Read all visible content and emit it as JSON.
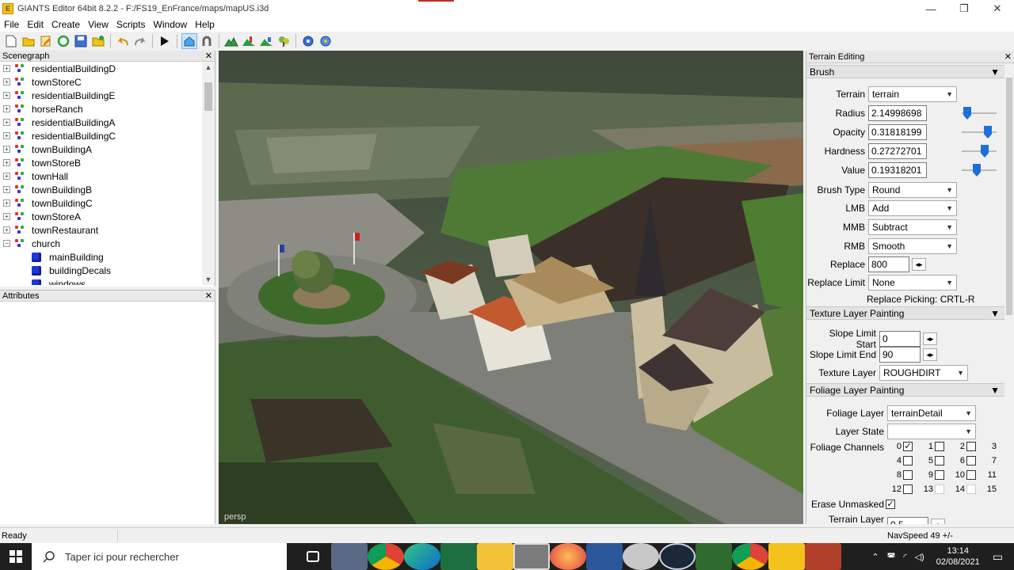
{
  "window": {
    "title": "GIANTS Editor 64bit 8.2.2 - F:/FS19_EnFrance/maps/mapUS.i3d",
    "app_icon": "E",
    "minimize": "—",
    "maximize": "❐",
    "close": "✕"
  },
  "menu": [
    "File",
    "Edit",
    "Create",
    "View",
    "Scripts",
    "Window",
    "Help"
  ],
  "scenegraph": {
    "title": "Scenegraph",
    "close": "✕",
    "items": [
      {
        "label": "residentialBuildingD",
        "type": "group",
        "expander": "+"
      },
      {
        "label": "townStoreC",
        "type": "group",
        "expander": "+"
      },
      {
        "label": "residentialBuildingE",
        "type": "group",
        "expander": "+"
      },
      {
        "label": "horseRanch",
        "type": "group",
        "expander": "+"
      },
      {
        "label": "residentialBuildingA",
        "type": "group",
        "expander": "+"
      },
      {
        "label": "residentialBuildingC",
        "type": "group",
        "expander": "+"
      },
      {
        "label": "townBuildingA",
        "type": "group",
        "expander": "+"
      },
      {
        "label": "townStoreB",
        "type": "group",
        "expander": "+"
      },
      {
        "label": "townHall",
        "type": "group",
        "expander": "+"
      },
      {
        "label": "townBuildingB",
        "type": "group",
        "expander": "+"
      },
      {
        "label": "townBuildingC",
        "type": "group",
        "expander": "+"
      },
      {
        "label": "townStoreA",
        "type": "group",
        "expander": "+"
      },
      {
        "label": "townRestaurant",
        "type": "group",
        "expander": "+"
      },
      {
        "label": "church",
        "type": "group",
        "expander": "−"
      },
      {
        "label": "mainBuilding",
        "type": "shape"
      },
      {
        "label": "buildingDecals",
        "type": "shape"
      },
      {
        "label": "windows",
        "type": "shape"
      }
    ]
  },
  "attributes": {
    "title": "Attributes",
    "close": "✕"
  },
  "viewport": {
    "camera_label": "persp"
  },
  "terrain_editing": {
    "title": "Terrain Editing",
    "close": "✕",
    "brush": {
      "title": "Brush",
      "terrain_label": "Terrain",
      "terrain_value": "terrain",
      "radius_label": "Radius",
      "radius_value": "2.14998698",
      "opacity_label": "Opacity",
      "opacity_value": "0.31818199",
      "hardness_label": "Hardness",
      "hardness_value": "0.27272701",
      "value_label": "Value",
      "value_value": "0.19318201",
      "brush_type_label": "Brush Type",
      "brush_type_value": "Round",
      "lmb_label": "LMB",
      "lmb_value": "Add",
      "mmb_label": "MMB",
      "mmb_value": "Subtract",
      "rmb_label": "RMB",
      "rmb_value": "Smooth",
      "replace_label": "Replace",
      "replace_value": "800",
      "replace_limit_label": "Replace Limit",
      "replace_limit_value": "None",
      "replace_picking": "Replace Picking: CRTL-R"
    },
    "texture": {
      "title": "Texture Layer Painting",
      "slope_start_label": "Slope Limit Start",
      "slope_start_value": "0",
      "slope_end_label": "Slope Limit End",
      "slope_end_value": "90",
      "texture_layer_label": "Texture Layer",
      "texture_layer_value": "ROUGHDIRT"
    },
    "foliage": {
      "title": "Foliage Layer Painting",
      "foliage_layer_label": "Foliage Layer",
      "foliage_layer_value": "terrainDetail",
      "layer_state_label": "Layer State",
      "layer_state_value": "",
      "channels_label": "Foliage Channels",
      "channels": [
        "0",
        "1",
        "2",
        "3",
        "4",
        "5",
        "6",
        "7",
        "8",
        "9",
        "10",
        "11",
        "12",
        "13",
        "14",
        "15"
      ],
      "erase_unmasked_label": "Erase Unmasked",
      "terrain_mask_label": "Terrain Layer Mask",
      "terrain_mask_value": "0.5"
    }
  },
  "status": {
    "left": "Ready",
    "right": "NavSpeed 49 +/-"
  },
  "taskbar": {
    "search_placeholder": "Taper ici pour rechercher",
    "time": "13:14",
    "date": "02/08/2021"
  },
  "colors": {
    "accent": "#1e6fd9",
    "taskbar": "#1f1f1f"
  }
}
